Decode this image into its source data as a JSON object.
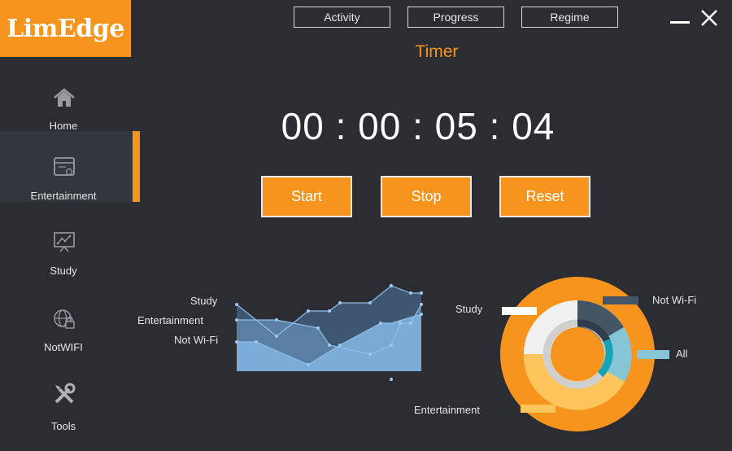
{
  "app": {
    "logo_text": "LimEdge"
  },
  "top_nav": {
    "tabs": [
      "Activity",
      "Progress",
      "Regime"
    ]
  },
  "page_title": "Timer",
  "sidebar": {
    "items": [
      {
        "label": "Home",
        "icon": "home-icon"
      },
      {
        "label": "Entertainment",
        "icon": "entertainment-icon",
        "active": true
      },
      {
        "label": "Study",
        "icon": "study-icon"
      },
      {
        "label": "NotWIFI",
        "icon": "globe-lock-icon"
      },
      {
        "label": "Tools",
        "icon": "tools-icon"
      }
    ]
  },
  "timer": {
    "hours": "00",
    "minutes": "00",
    "seconds": "05",
    "centis": "04",
    "separator": ":"
  },
  "controls": {
    "start_label": "Start",
    "stop_label": "Stop",
    "reset_label": "Reset"
  },
  "colors": {
    "accent": "#f7941d",
    "background": "#2b2d33"
  },
  "area_chart": {
    "legend": [
      "Study",
      "Entertainment",
      "Not Wi-Fi"
    ]
  },
  "donut_chart": {
    "labels": [
      "Study",
      "Not Wi-Fi",
      "All",
      "Entertainment"
    ]
  }
}
